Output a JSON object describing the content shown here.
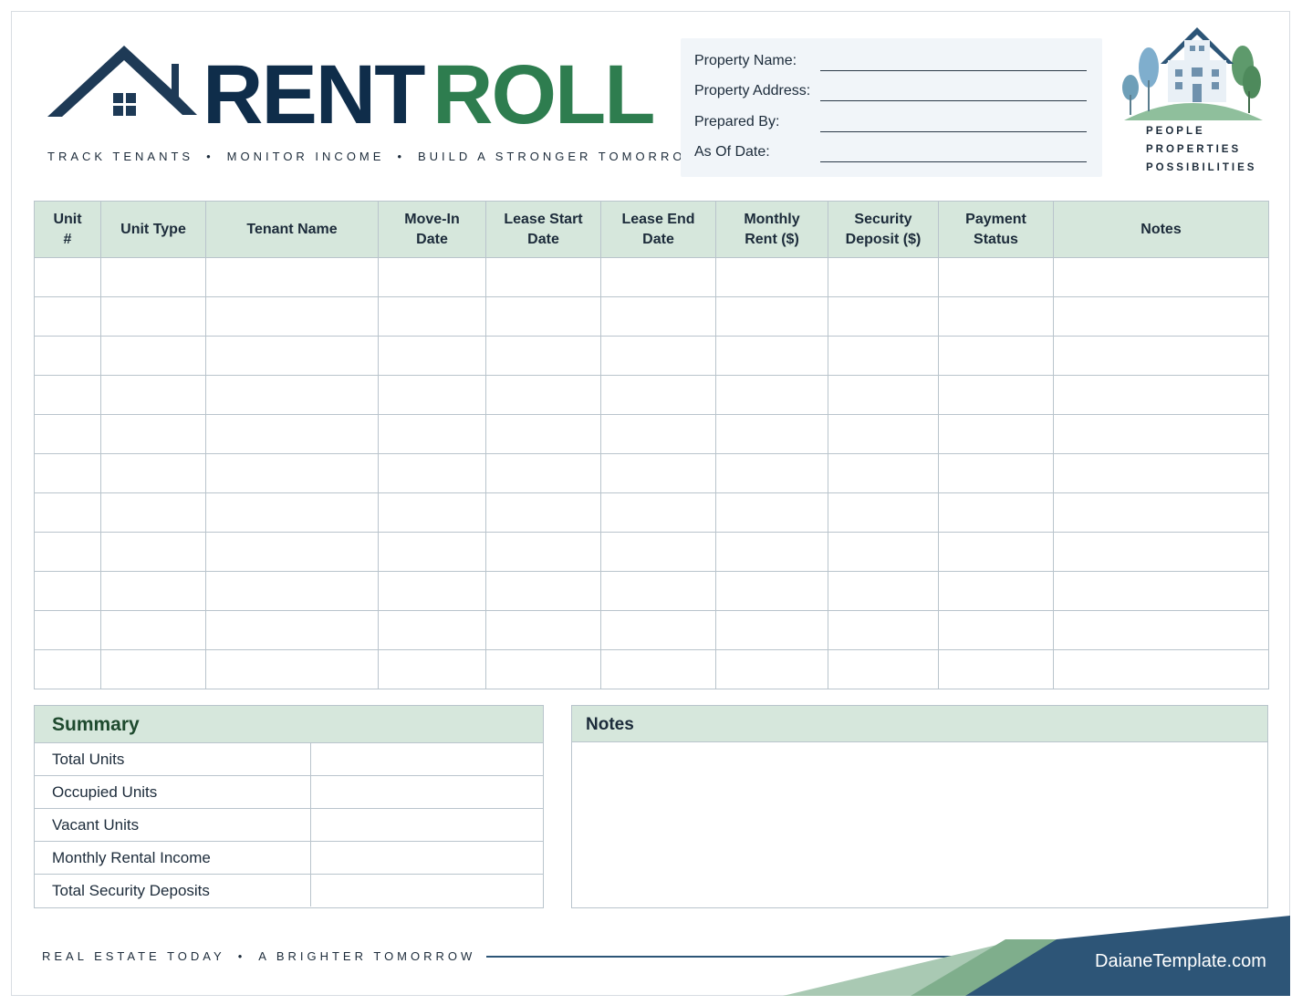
{
  "header": {
    "title_part1": "RENT",
    "title_part2": "ROLL",
    "tagline": [
      "TRACK TENANTS",
      "MONITOR INCOME",
      "BUILD A STRONGER TOMORROW"
    ],
    "tagline_separator": "•"
  },
  "property_info": {
    "fields": [
      {
        "label": "Property Name:",
        "value": ""
      },
      {
        "label": "Property Address:",
        "value": ""
      },
      {
        "label": "Prepared By:",
        "value": ""
      },
      {
        "label": "As Of Date:",
        "value": ""
      }
    ]
  },
  "brand": {
    "lines": [
      "PEOPLE",
      "PROPERTIES",
      "POSSIBILITIES"
    ]
  },
  "table": {
    "columns": [
      "Unit\n#",
      "Unit Type",
      "Tenant Name",
      "Move-In\nDate",
      "Lease Start\nDate",
      "Lease End\nDate",
      "Monthly\nRent ($)",
      "Security\nDeposit ($)",
      "Payment\nStatus",
      "Notes"
    ],
    "rows": [
      [
        "",
        "",
        "",
        "",
        "",
        "",
        "",
        "",
        "",
        ""
      ],
      [
        "",
        "",
        "",
        "",
        "",
        "",
        "",
        "",
        "",
        ""
      ],
      [
        "",
        "",
        "",
        "",
        "",
        "",
        "",
        "",
        "",
        ""
      ],
      [
        "",
        "",
        "",
        "",
        "",
        "",
        "",
        "",
        "",
        ""
      ],
      [
        "",
        "",
        "",
        "",
        "",
        "",
        "",
        "",
        "",
        ""
      ],
      [
        "",
        "",
        "",
        "",
        "",
        "",
        "",
        "",
        "",
        ""
      ],
      [
        "",
        "",
        "",
        "",
        "",
        "",
        "",
        "",
        "",
        ""
      ],
      [
        "",
        "",
        "",
        "",
        "",
        "",
        "",
        "",
        "",
        ""
      ],
      [
        "",
        "",
        "",
        "",
        "",
        "",
        "",
        "",
        "",
        ""
      ],
      [
        "",
        "",
        "",
        "",
        "",
        "",
        "",
        "",
        "",
        ""
      ],
      [
        "",
        "",
        "",
        "",
        "",
        "",
        "",
        "",
        "",
        ""
      ]
    ]
  },
  "summary": {
    "title": "Summary",
    "rows": [
      {
        "label": "Total Units",
        "value": ""
      },
      {
        "label": "Occupied Units",
        "value": ""
      },
      {
        "label": "Vacant Units",
        "value": ""
      },
      {
        "label": "Monthly Rental Income",
        "value": ""
      },
      {
        "label": "Total Security Deposits",
        "value": ""
      }
    ]
  },
  "notes": {
    "title": "Notes",
    "content": ""
  },
  "footer": {
    "tagline": [
      "REAL ESTATE TODAY",
      "A BRIGHTER TOMORROW"
    ],
    "tagline_separator": "•",
    "url": "DaianeTemplate.com"
  },
  "colors": {
    "navy": "#0f2d4a",
    "green": "#2e7d4f",
    "header_fill": "#d6e7dc",
    "info_box": "#f1f5f9",
    "footer_blue": "#2d5577"
  },
  "icons": {
    "main_logo": "house-roof-icon",
    "brand_logo": "house-with-trees-icon"
  }
}
